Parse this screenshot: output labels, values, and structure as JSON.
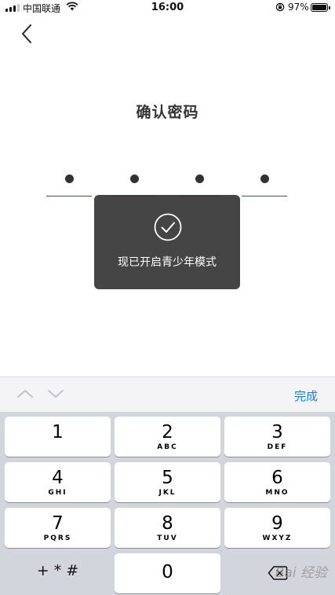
{
  "status_bar": {
    "carrier": "中国联通",
    "time": "16:00",
    "battery_percent": "97%",
    "battery_level": 0.97,
    "icons": [
      "signal-icon",
      "wifi-icon",
      "rotation-lock-icon",
      "battery-icon"
    ]
  },
  "nav": {
    "back_icon": "chevron-left-icon"
  },
  "page": {
    "title": "确认密码"
  },
  "pin": {
    "length": 4,
    "filled": 4
  },
  "toast": {
    "icon": "check-circle-icon",
    "message": "现已开启青少年模式"
  },
  "keyboard": {
    "accessory": {
      "prev_icon": "chevron-up-icon",
      "next_icon": "chevron-down-icon",
      "done_label": "完成"
    },
    "keys": [
      {
        "num": "1",
        "letters": ""
      },
      {
        "num": "2",
        "letters": "ABC"
      },
      {
        "num": "3",
        "letters": "DEF"
      },
      {
        "num": "4",
        "letters": "GHI"
      },
      {
        "num": "5",
        "letters": "JKL"
      },
      {
        "num": "6",
        "letters": "MNO"
      },
      {
        "num": "7",
        "letters": "PQRS"
      },
      {
        "num": "8",
        "letters": "TUV"
      },
      {
        "num": "9",
        "letters": "WXYZ"
      },
      {
        "num": "0",
        "letters": ""
      }
    ],
    "symbols_label": "+ * #",
    "delete_icon": "backspace-icon"
  },
  "watermark": "Bai 经验"
}
